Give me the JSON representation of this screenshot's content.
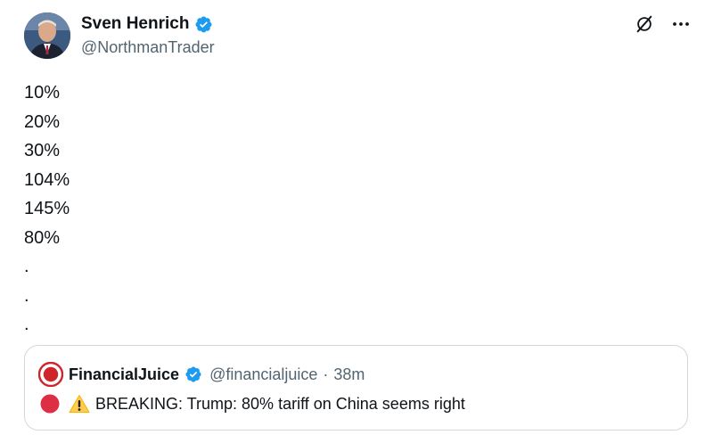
{
  "author": {
    "display_name": "Sven Henrich",
    "handle": "@NorthmanTrader",
    "verified": true
  },
  "tweet": {
    "lines": [
      "10%",
      "20%",
      "30%",
      "104%",
      "145%",
      "80%",
      ".",
      ".",
      "."
    ]
  },
  "quoted_tweet": {
    "display_name": "FinancialJuice",
    "handle": "@financialjuice",
    "separator": "·",
    "time": "38m",
    "text": "BREAKING: Trump: 80% tariff on China seems right"
  },
  "icons": {
    "verified": "verified-badge-icon",
    "grok": "grok-icon",
    "more": "more-options-icon",
    "alert": "red-circle-icon",
    "warning": "warning-icon"
  },
  "colors": {
    "verified_blue": "#1d9bf0",
    "handle_gray": "#536471",
    "text": "#0f1419",
    "border": "#cfd9de",
    "alert_red": "#dd2e44"
  }
}
